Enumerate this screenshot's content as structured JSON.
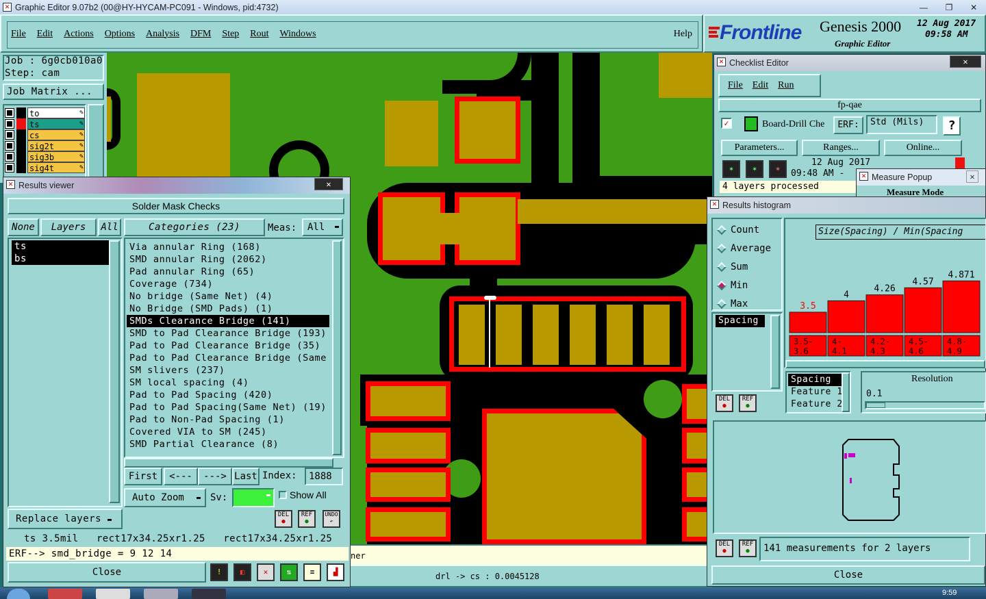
{
  "window": {
    "title": "Graphic Editor 9.07b2 (00@HY-HYCAM-PC091 - Windows, pid:4732)",
    "controls": [
      "—",
      "❐",
      "✕"
    ]
  },
  "menu": {
    "items": [
      "File",
      "Edit",
      "Actions",
      "Options",
      "Analysis",
      "DFM",
      "Step",
      "Rout",
      "Windows"
    ],
    "help": "Help"
  },
  "brand": {
    "logo": "Frontline",
    "product": "Genesis 2000",
    "subtitle": "Graphic Editor",
    "date": "12 Aug 2017",
    "time": "09:58 AM"
  },
  "job": {
    "job_label": "Job",
    "job_value": "6g0cb010a0",
    "step_label": "Step:",
    "step_value": "cam",
    "matrix_button": "Job Matrix ..."
  },
  "layers": [
    {
      "name": "to",
      "color": "#ffffff"
    },
    {
      "name": "ts",
      "color": "#1b9e8a"
    },
    {
      "name": "cs",
      "color": "#f4c542"
    },
    {
      "name": "sig2t",
      "color": "#f4c542"
    },
    {
      "name": "sig3b",
      "color": "#f4c542"
    },
    {
      "name": "sig4t",
      "color": "#f4c542"
    }
  ],
  "results_viewer": {
    "title": "Results viewer",
    "header": "Solder Mask Checks",
    "none_btn": "None",
    "layers_btn": "Layers",
    "all_btn": "All",
    "categories_btn": "Categories (23)",
    "meas_label": "Meas:",
    "meas_value": "All",
    "layer_list": [
      "ts",
      "bs"
    ],
    "categories": [
      "Via annular Ring (168)",
      "SMD annular Ring (2062)",
      "Pad annular Ring (65)",
      "Coverage (734)",
      "No bridge (Same Net) (4)",
      "No Bridge (SMD Pads) (1)",
      "SMDs Clearance Bridge (141)",
      "SMD to Pad Clearance Bridge (193)",
      "Pad to Pad Clearance Bridge (35)",
      "Pad to Pad Clearance Bridge (Same",
      "SM slivers (237)",
      "SM local spacing (4)",
      "Pad to Pad Spacing (420)",
      "Pad to Pad Spacing(Same Net) (19)",
      "Pad to Non-Pad Spacing (1)",
      "Covered VIA to SM (245)",
      "SMD Partial Clearance (8)"
    ],
    "selected_index": 6,
    "first": "First",
    "prev": "<---",
    "next": "--->",
    "last": "Last",
    "index_label": "Index:",
    "index_value": "1888",
    "auto_zoom": "Auto Zoom",
    "sv_label": "Sv:",
    "show_all": "Show All",
    "replace_layers": "Replace layers",
    "del": "DEL",
    "ref": "REF",
    "undo": "UNDO",
    "status_line": "ts 3.5mil   rect17x34.25xr1.25   rect17x34.25xr1.25",
    "erf_line": "ERF--> smd_bridge = 9 12 14",
    "close": "Close"
  },
  "checklist": {
    "title": "Checklist Editor",
    "menu": [
      "File",
      "Edit",
      "Run"
    ],
    "name": "fp-qae",
    "action": "Board-Drill Che",
    "erf": "ERF:",
    "std": "Std (Mils)",
    "help": "?",
    "parameters": "Parameters...",
    "ranges": "Ranges...",
    "online": "Online...",
    "run_date": "12 Aug 2017",
    "run_time": "09:48 AM -",
    "status": "4 layers processed"
  },
  "measure_popup": {
    "title": "Measure Popup",
    "mode": "Measure Mode"
  },
  "histogram": {
    "title": "Results histogram",
    "options": [
      "Count",
      "Average",
      "Sum",
      "Min",
      "Max"
    ],
    "selected_option": "Min",
    "chart_title": "Size(Spacing) / Min(Spacing",
    "param_list": [
      "Spacing"
    ],
    "lower_list": [
      "Spacing",
      "Feature 1",
      "Feature 2"
    ],
    "resolution_label": "Resolution",
    "resolution_value": "0.1",
    "del": "DEL",
    "ref": "REF",
    "summary": "141 measurements for 2 layers",
    "close": "Close"
  },
  "chart_data": {
    "type": "bar",
    "title": "Size(Spacing) / Min(Spacing",
    "categories": [
      "3.5-\n3.6",
      "4-\n4.1",
      "4.2-\n4.3",
      "4.5-\n4.6",
      "4.8-\n4.9"
    ],
    "series": [
      {
        "values": [
          3.5,
          4,
          4.26,
          4.57,
          4.871
        ]
      }
    ],
    "data_labels": [
      "3.5",
      "4",
      "4.26",
      "4.57",
      "4.871"
    ],
    "highlight_color": "#ff0000",
    "bar_color": "#ff0000"
  },
  "footer": {
    "measure_line": "drl -> cs : 0.0045128",
    "partial_text": "ner"
  },
  "taskbar": {
    "clock": "9:59"
  }
}
